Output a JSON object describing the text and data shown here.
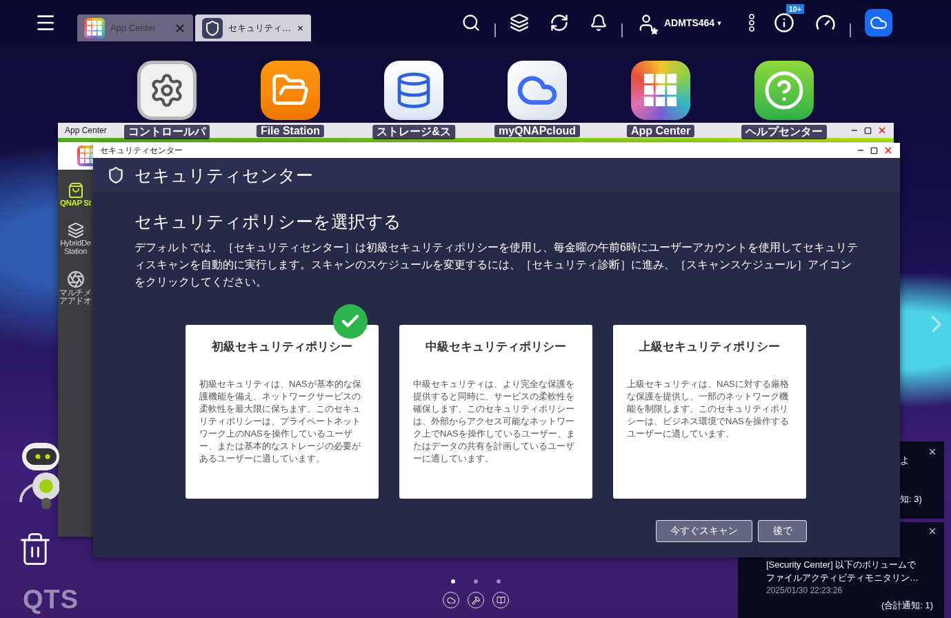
{
  "topbar": {
    "tabs": [
      {
        "label": "App Center",
        "kind": "appcenter",
        "selected": false
      },
      {
        "label": "セキュリティ…",
        "kind": "security",
        "selected": true
      }
    ],
    "user": "ADMTS464",
    "caret": "▾",
    "badge": "10+"
  },
  "desktop_icons": [
    {
      "label": "コントロールパ",
      "kind": "settings"
    },
    {
      "label": "File Station",
      "kind": "folder"
    },
    {
      "label": "ストレージ&ス",
      "kind": "storage"
    },
    {
      "label": "myQNAPcloud",
      "kind": "cloud"
    },
    {
      "label": "App Center",
      "kind": "appcenter"
    },
    {
      "label": "ヘルプセンター",
      "kind": "help"
    }
  ],
  "back_window": {
    "title": "App Center",
    "sidebar": [
      {
        "lines": [
          "QNAP St"
        ],
        "kind": "store",
        "selected": true
      },
      {
        "lines": [
          "HybridDe",
          "Station"
        ],
        "kind": "hd",
        "selected": false
      },
      {
        "lines": [
          "マルチメ",
          "アアドオ"
        ],
        "kind": "media",
        "selected": false
      }
    ]
  },
  "dialog": {
    "title": "セキュリティセンター",
    "header": "セキュリティセンター",
    "heading": "セキュリティポリシーを選択する",
    "description": "デフォルトでは、［セキュリティセンター］は初級セキュリティポリシーを使用し、毎金曜の午前6時にユーザーアカウントを使用してセキュリティスキャンを自動的に実行します。スキャンのスケジュールを変更するには、［セキュリティ診断］に進み、［スキャンスケジュール］アイコンをクリックしてください。",
    "policies": [
      {
        "title": "初級セキュリティポリシー",
        "text": "初級セキュリティは、NASが基本的な保護機能を備え、ネットワークサービスの柔軟性を最大限に保ちます。このセキュリティポリシーは、プライベートネットワーク上のNASを操作しているユーザー、または基本的なストレージの必要があるユーザーに適しています。",
        "selected": true
      },
      {
        "title": "中級セキュリティポリシー",
        "text": "中級セキュリティは、より完全な保護を提供すると同時に、サービスの柔軟性を確保します。このセキュリティポリシーは、外部からアクセス可能なネットワーク上でNASを操作しているユーザー、またはデータの共有を計画しているユーザーに適しています。",
        "selected": false
      },
      {
        "title": "上級セキュリティポリシー",
        "text": "上級セキュリティは、NASに対する厳格な保護を提供し、一部のネットワーク機能を制限します。このセキュリティポリシーは、ビジネス環境でNASを操作するユーザーに適しています。",
        "selected": false
      }
    ],
    "buttons": [
      "今すぐスキャン",
      "後で"
    ]
  },
  "notifications": [
    {
      "lines": [
        "よ"
      ],
      "total": "知: 3)"
    },
    {
      "lines": [
        "[Security Center] 以下のボリュームで",
        "ファイルアクティビティモニタリン…"
      ],
      "time": "2025/01/30 22:23:26",
      "total": "(合計通知: 1)"
    }
  ],
  "pager": [
    {
      "selected": true
    },
    {
      "selected": false
    },
    {
      "selected": false
    }
  ],
  "logo": "QTS"
}
